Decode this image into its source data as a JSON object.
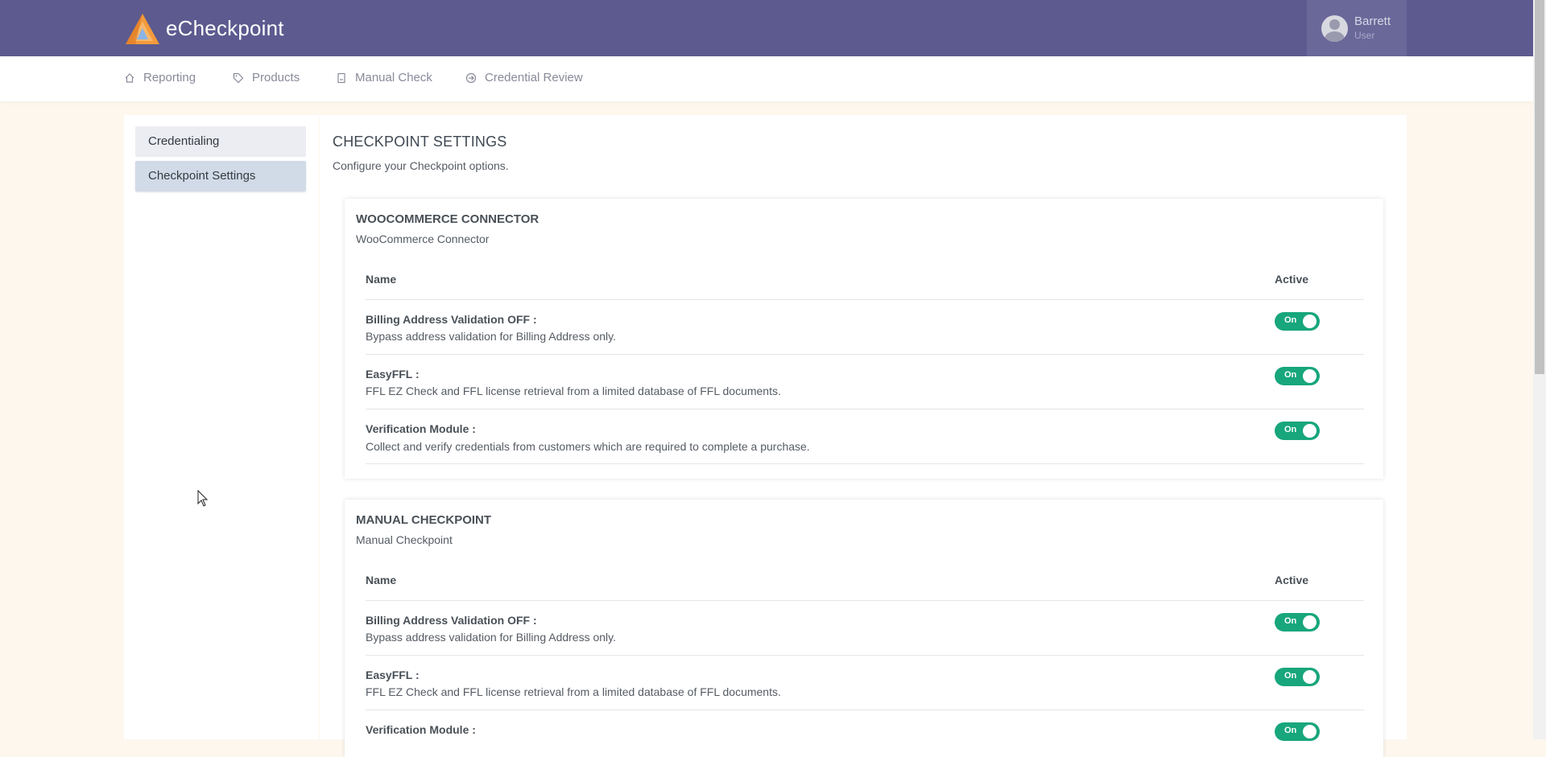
{
  "app": {
    "brand": "eCheckpoint"
  },
  "user": {
    "name": "Barrett",
    "role": "User"
  },
  "nav": [
    {
      "label": "Reporting",
      "icon": "home-icon"
    },
    {
      "label": "Products",
      "icon": "tag-icon"
    },
    {
      "label": "Manual Check",
      "icon": "document-icon"
    },
    {
      "label": "Credential Review",
      "icon": "arrow-circle-icon"
    }
  ],
  "sidebar": [
    {
      "label": "Credentialing"
    },
    {
      "label": "Checkpoint Settings"
    }
  ],
  "page": {
    "title": "CHECKPOINT SETTINGS",
    "subtitle": "Configure your Checkpoint options."
  },
  "table_headers": {
    "name": "Name",
    "active": "Active"
  },
  "cards": [
    {
      "title": "WOOCOMMERCE CONNECTOR",
      "subtitle": "WooCommerce Connector",
      "rows": [
        {
          "title": "Billing Address Validation OFF :",
          "desc": "Bypass address validation for Billing Address only.",
          "toggle": "On"
        },
        {
          "title": "EasyFFL :",
          "desc": "FFL EZ Check and FFL license retrieval from a limited database of FFL documents.",
          "toggle": "On"
        },
        {
          "title": "Verification Module :",
          "desc": "Collect and verify credentials from customers which are required to complete a purchase.",
          "toggle": "On"
        }
      ]
    },
    {
      "title": "MANUAL CHECKPOINT",
      "subtitle": "Manual Checkpoint",
      "rows": [
        {
          "title": "Billing Address Validation OFF :",
          "desc": "Bypass address validation for Billing Address only.",
          "toggle": "On"
        },
        {
          "title": "EasyFFL :",
          "desc": "FFL EZ Check and FFL license retrieval from a limited database of FFL documents.",
          "toggle": "On"
        },
        {
          "title": "Verification Module :",
          "desc": "",
          "toggle": "On"
        }
      ]
    }
  ],
  "colors": {
    "header": "#5c5a8f",
    "toggle_on": "#18a67c",
    "background": "#fdf7ee"
  }
}
